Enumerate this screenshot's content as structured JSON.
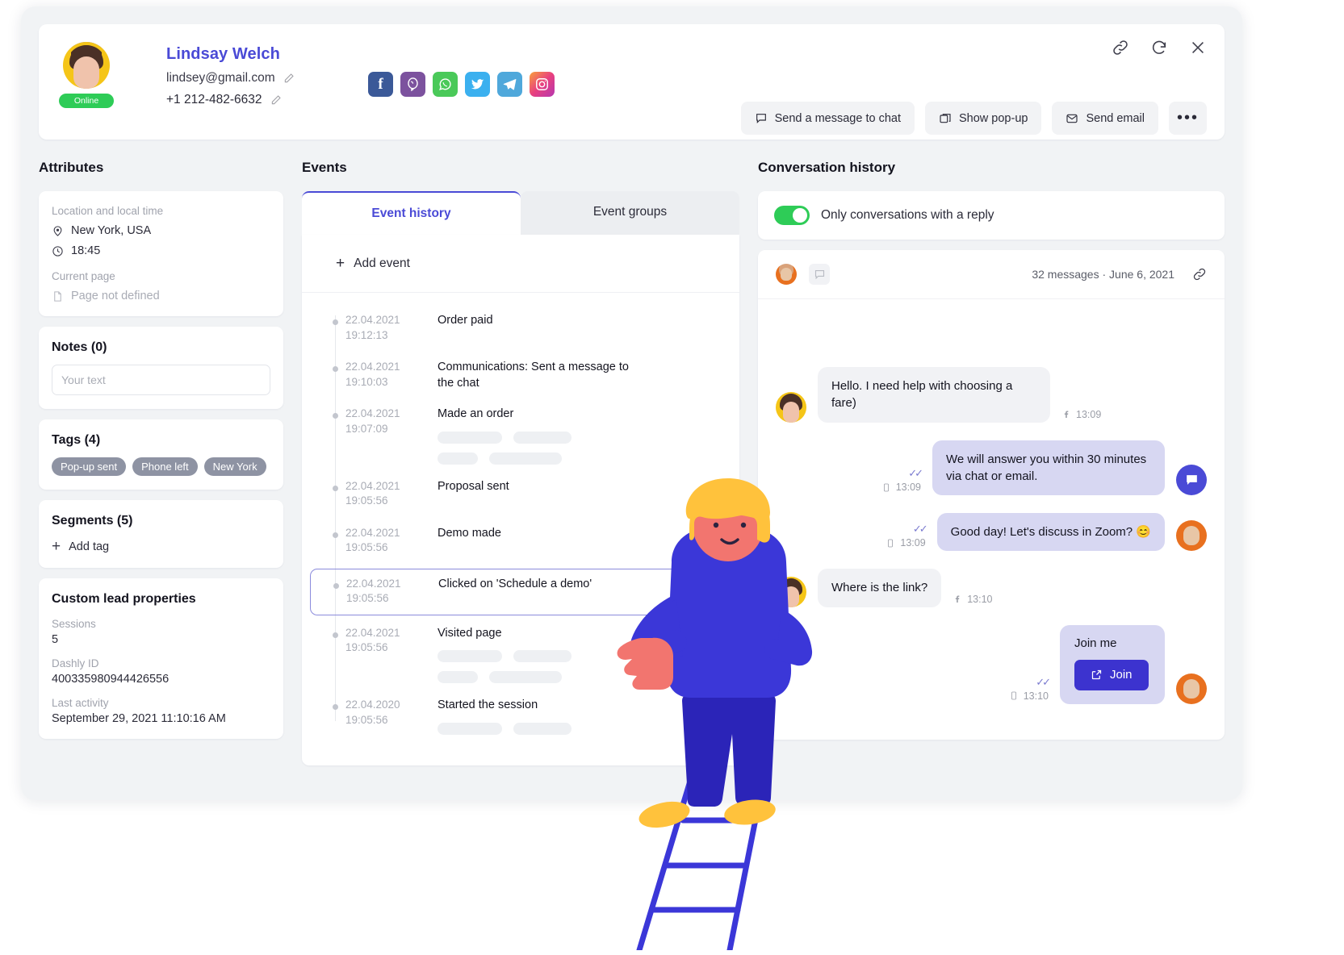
{
  "header": {
    "name": "Lindsay Welch",
    "email": "lindsey@gmail.com",
    "phone": "+1 212-482-6632",
    "status": "Online",
    "socials": [
      "facebook-icon",
      "viber-icon",
      "whatsapp-icon",
      "twitter-icon",
      "telegram-icon",
      "instagram-icon"
    ],
    "icons": [
      "link-icon",
      "refresh-icon",
      "close-icon"
    ],
    "actions": {
      "send_message": "Send a message to chat",
      "show_popup": "Show pop-up",
      "send_email": "Send email",
      "more": "•••"
    }
  },
  "attributes": {
    "title": "Attributes",
    "location_label": "Location and local time",
    "location": "New York, USA",
    "local_time": "18:45",
    "current_page_label": "Current page",
    "current_page": "Page not defined",
    "notes_title": "Notes (0)",
    "notes_placeholder": "Your text",
    "notes_value": "",
    "tags_title": "Tags (4)",
    "tags": [
      "Pop-up sent",
      "Phone left",
      "New York"
    ],
    "segments_title": "Segments (5)",
    "add_tag": "Add tag",
    "custom_title": "Custom lead properties",
    "properties": [
      {
        "label": "Sessions",
        "value": "5"
      },
      {
        "label": "Dashly ID",
        "value": "400335980944426556"
      },
      {
        "label": "Last activity",
        "value": "September 29, 2021 11:10:16 AM"
      }
    ]
  },
  "events": {
    "title": "Events",
    "tabs": [
      {
        "label": "Event history",
        "active": true
      },
      {
        "label": "Event groups",
        "active": false
      }
    ],
    "add_event": "Add event",
    "items": [
      {
        "date": "22.04.2021",
        "time": "19:12:13",
        "name": "Order paid",
        "skeleton": 0,
        "selected": false
      },
      {
        "date": "22.04.2021",
        "time": "19:10:03",
        "name": "Communications: Sent a message to the chat",
        "skeleton": 0,
        "selected": false
      },
      {
        "date": "22.04.2021",
        "time": "19:07:09",
        "name": "Made an order",
        "skeleton": 2,
        "selected": false
      },
      {
        "date": "22.04.2021",
        "time": "19:05:56",
        "name": "Proposal sent",
        "skeleton": 0,
        "selected": false
      },
      {
        "date": "22.04.2021",
        "time": "19:05:56",
        "name": "Demo made",
        "skeleton": 0,
        "selected": false
      },
      {
        "date": "22.04.2021",
        "time": "19:05:56",
        "name": "Clicked on 'Schedule a demo'",
        "skeleton": 0,
        "selected": true
      },
      {
        "date": "22.04.2021",
        "time": "19:05:56",
        "name": "Visited page",
        "skeleton": 2,
        "selected": false
      },
      {
        "date": "22.04.2020",
        "time": "19:05:56",
        "name": "Started the session",
        "skeleton": 1,
        "selected": false
      }
    ]
  },
  "conversation": {
    "title": "Conversation history",
    "toggle_label": "Only conversations with a reply",
    "toggle_on": true,
    "meta": "32 messages · June 6, 2021",
    "messages": [
      {
        "side": "in",
        "text": "Hello. I need help with choosing a fare)",
        "time": "13:09",
        "channel": "facebook-icon",
        "avatar": "user"
      },
      {
        "side": "out",
        "text": "We will answer you within 30 minutes via chat or email.",
        "time": "13:09",
        "channel": "device-icon",
        "ticks": "✓✓",
        "avatar": "bot"
      },
      {
        "side": "out",
        "text": "Good day! Let's discuss in Zoom? 😊",
        "time": "13:09",
        "channel": "device-icon",
        "ticks": "✓✓",
        "avatar": "agent"
      },
      {
        "side": "in",
        "text": "Where is the link?",
        "time": "13:10",
        "channel": "facebook-icon",
        "avatar": "user"
      },
      {
        "side": "out",
        "card": true,
        "card_title": "Join me",
        "button": "Join",
        "time": "13:10",
        "channel": "device-icon",
        "ticks": "✓✓",
        "avatar": "agent"
      }
    ]
  },
  "colors": {
    "accent": "#4a4ad6",
    "online": "#2ecc57",
    "bubble_out": "#d7d7f2",
    "bubble_in": "#f1f2f5",
    "join_button": "#3c33cf"
  }
}
